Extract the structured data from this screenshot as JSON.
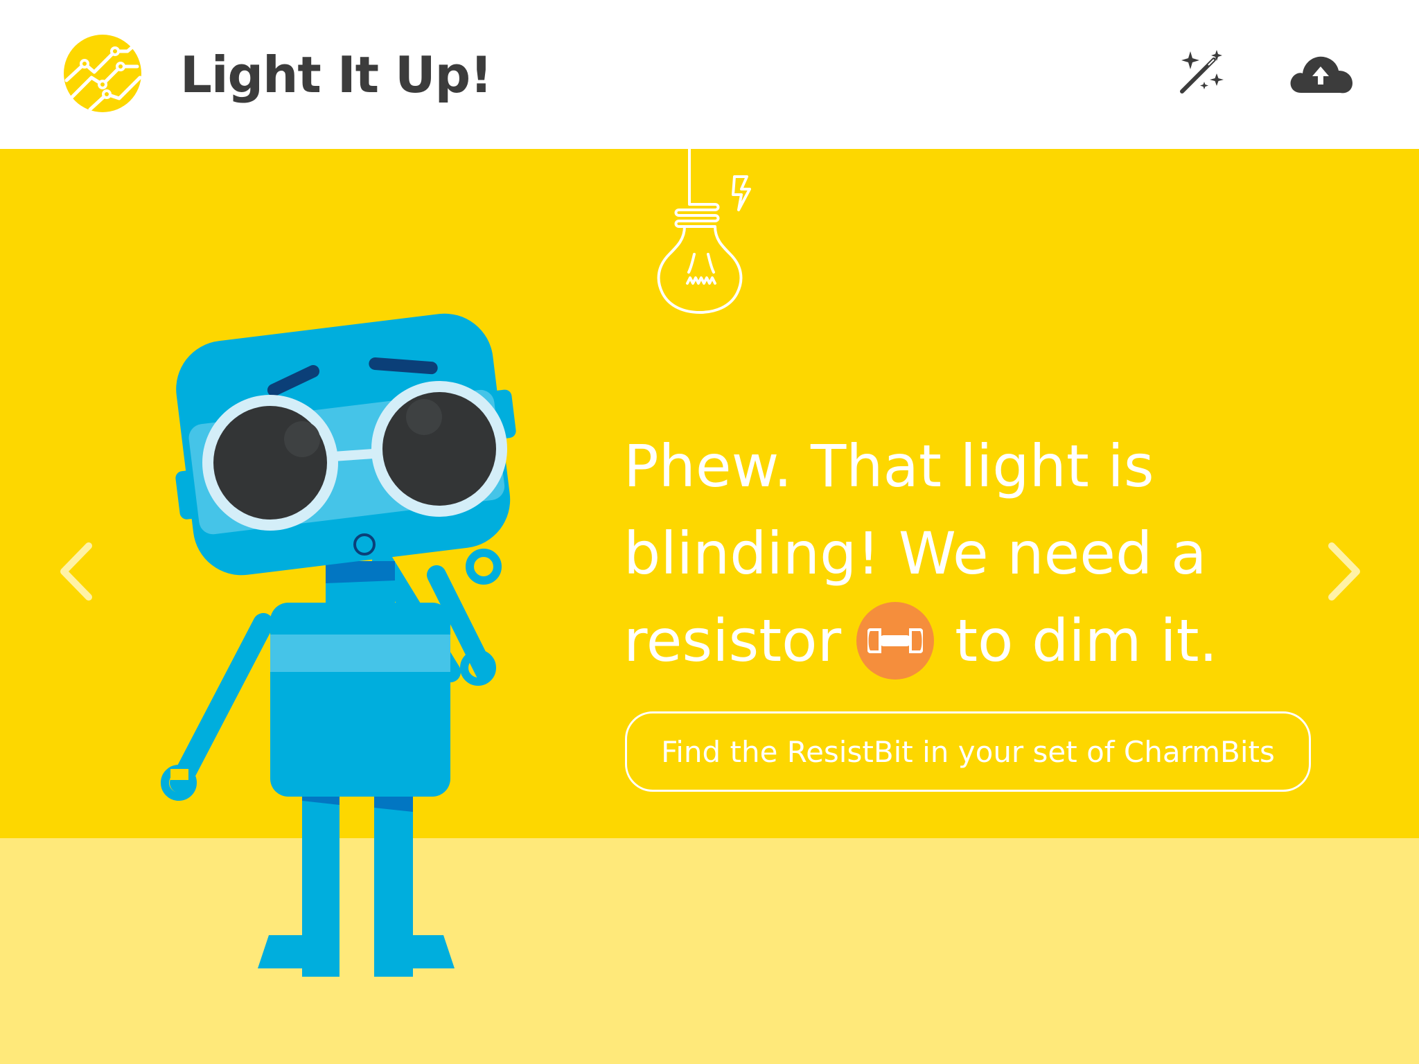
{
  "header": {
    "title": "Light It Up!",
    "logo_icon": "circuit-badge-icon",
    "actions": [
      {
        "name": "magic-wand-button",
        "icon": "magic-wand-icon"
      },
      {
        "name": "cloud-upload-button",
        "icon": "cloud-upload-icon"
      }
    ]
  },
  "message": {
    "line1": "Phew. That light is",
    "line2": "blinding! We need a",
    "line3_before": "resistor",
    "line3_after": "to dim it.",
    "inline_icon": "resistor-icon"
  },
  "hint_button": {
    "label": "Find the ResistBit in your set of CharmBits"
  },
  "navigation": {
    "prev_icon": "chevron-left-icon",
    "next_icon": "chevron-right-icon"
  },
  "colors": {
    "stage": "#FDD700",
    "floor": "#FFE97A",
    "header_bg": "#FFFFFF",
    "title_text": "#3C3C3C",
    "robot_blue": "#00AEDD",
    "resistor_badge": "#F58E3C",
    "goggle_frame": "#D4EEF8"
  }
}
